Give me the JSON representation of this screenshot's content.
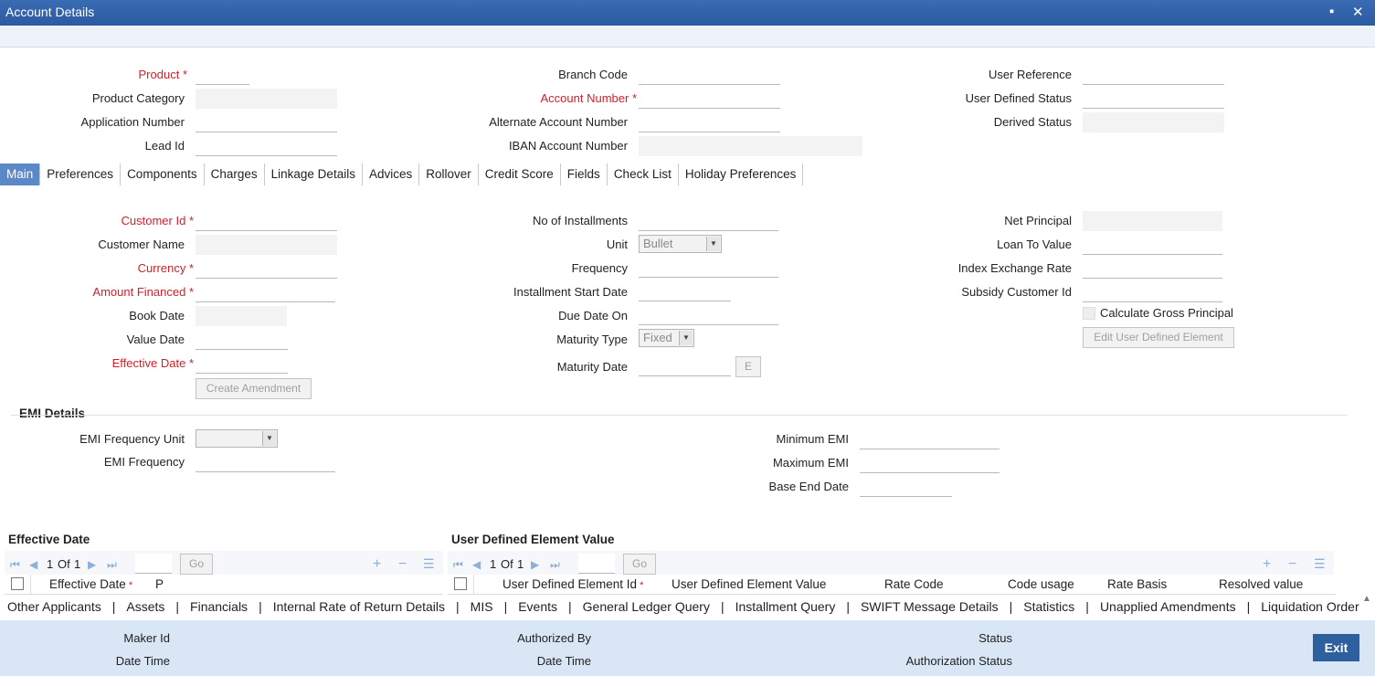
{
  "window": {
    "title": "Account Details",
    "minimize_icon": "▪",
    "close_icon": "✕"
  },
  "header": {
    "product": "Product",
    "product_category": "Product Category",
    "application_number": "Application Number",
    "lead_id": "Lead Id",
    "branch_code": "Branch Code",
    "account_number": "Account Number",
    "alternate_account_number": "Alternate Account Number",
    "iban_account_number": "IBAN Account Number",
    "user_reference": "User Reference",
    "user_defined_status": "User Defined Status",
    "derived_status": "Derived Status"
  },
  "tabs": [
    "Main",
    "Preferences",
    "Components",
    "Charges",
    "Linkage Details",
    "Advices",
    "Rollover",
    "Credit Score",
    "Fields",
    "Check List",
    "Holiday Preferences"
  ],
  "main": {
    "customer_id": "Customer Id",
    "customer_name": "Customer Name",
    "currency": "Currency",
    "amount_financed": "Amount Financed",
    "book_date": "Book Date",
    "value_date": "Value Date",
    "effective_date": "Effective Date",
    "create_amendment": "Create Amendment",
    "no_of_installments": "No of Installments",
    "unit": "Unit",
    "unit_value": "Bullet",
    "frequency": "Frequency",
    "installment_start_date": "Installment Start Date",
    "due_date_on": "Due Date On",
    "maturity_type": "Maturity Type",
    "maturity_type_value": "Fixed",
    "maturity_date": "Maturity Date",
    "e_button": "E",
    "net_principal": "Net Principal",
    "loan_to_value": "Loan To Value",
    "index_exchange_rate": "Index Exchange Rate",
    "subsidy_customer_id": "Subsidy Customer Id",
    "calculate_gross_principal": "Calculate Gross Principal",
    "edit_user_defined_element": "Edit User Defined Element"
  },
  "emi": {
    "title": "EMI Details",
    "frequency_unit": "EMI Frequency Unit",
    "frequency": "EMI Frequency",
    "minimum_emi": "Minimum EMI",
    "maximum_emi": "Maximum EMI",
    "base_end_date": "Base End Date"
  },
  "effective_date_grid": {
    "title": "Effective Date",
    "page": "1",
    "of_label": "Of",
    "total": "1",
    "go": "Go",
    "columns": [
      "Effective Date",
      "P"
    ]
  },
  "ude_grid": {
    "title": "User Defined Element Value",
    "page": "1",
    "of_label": "Of",
    "total": "1",
    "go": "Go",
    "columns": [
      "User Defined Element Id",
      "User Defined Element Value",
      "Rate Code",
      "Code usage",
      "Rate Basis",
      "Resolved value"
    ]
  },
  "links": [
    "Other Applicants",
    "Assets",
    "Financials",
    "Internal Rate of Return Details",
    "MIS",
    "Events",
    "General Ledger Query",
    "Installment Query",
    "SWIFT Message Details",
    "Statistics",
    "Unapplied Amendments",
    "Liquidation Order"
  ],
  "footer": {
    "maker_id": "Maker Id",
    "date_time_1": "Date Time",
    "authorized_by": "Authorized By",
    "date_time_2": "Date Time",
    "status": "Status",
    "authorization_status": "Authorization Status",
    "exit": "Exit"
  }
}
